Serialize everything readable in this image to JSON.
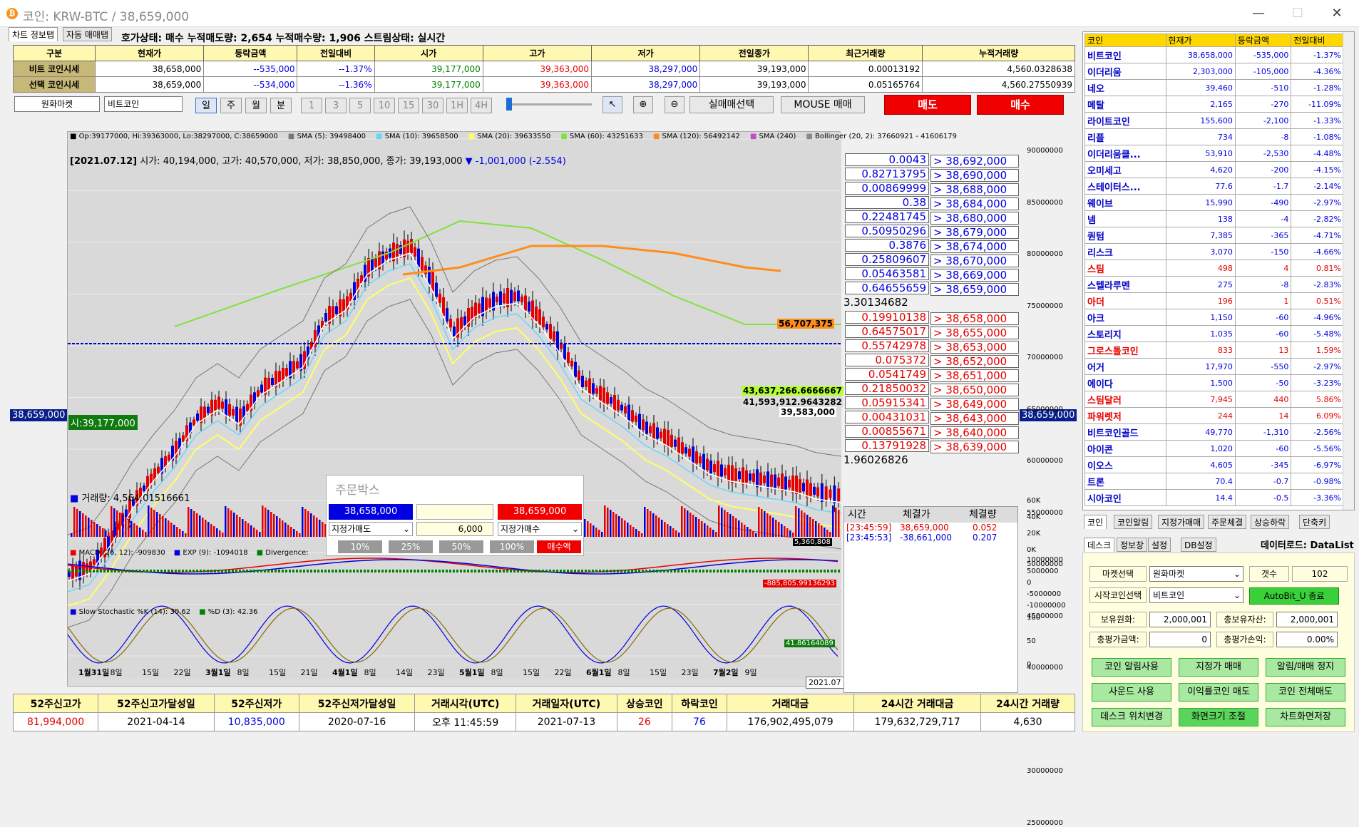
{
  "window": {
    "title": "코인: KRW-BTC / 38,659,000",
    "min": "—",
    "max": "☐",
    "close": "✕"
  },
  "tabs": {
    "chart_info": "차트 정보탭",
    "auto_trade": "자동 매매탭"
  },
  "status_text": "호가상태: 매수 누적매도량: 2,654 누적매수량: 1,906 스트림상태: 실시간",
  "summary": {
    "headers": [
      "구분",
      "현재가",
      "등락금액",
      "전일대비",
      "시가",
      "고가",
      "저가",
      "전일종가",
      "최근거래량",
      "누적거래량"
    ],
    "rows": [
      {
        "label": "비트 코인시세",
        "cells": [
          "38,658,000",
          "--535,000",
          "--1.37%",
          "39,177,000",
          "39,363,000",
          "38,297,000",
          "39,193,000",
          "0.00013192",
          "4,560.0328638"
        ]
      },
      {
        "label": "선택 코인시세",
        "cells": [
          "38,659,000",
          "--534,000",
          "--1.36%",
          "39,177,000",
          "39,363,000",
          "38,297,000",
          "39,193,000",
          "0.05165764",
          "4,560.27550939"
        ]
      }
    ]
  },
  "toolbar": {
    "market": "원화마켓",
    "coin": "비트코인",
    "periods": [
      "일",
      "주",
      "월",
      "분"
    ],
    "minutes": [
      "1",
      "3",
      "5",
      "10",
      "15",
      "30",
      "1H",
      "4H"
    ],
    "real_trade": "실매매선택",
    "mouse_trade": "MOUSE 매매",
    "sell": "매도",
    "buy": "매수"
  },
  "chart": {
    "legend": [
      "Op:39177000, Hi:39363000, Lo:38297000, C:38659000",
      "SMA (5): 39498400",
      "SMA (10): 39658500",
      "SMA (20): 39633550",
      "SMA (60): 43251633",
      "SMA (120): 56492142",
      "SMA (240)",
      "Bollinger (20, 2): 37660921 - 41606179"
    ],
    "info_date": "[2021.07.12]",
    "info_text": " 시가: 40,194,000, 고가: 40,570,000, 저가: 38,850,000, 종가: 39,193,000",
    "info_change": "▼ -1,001,000 (-2.554)",
    "price_left": "38,659,000",
    "open_tag": "시:39,177,000",
    "price_right": "38,659,000",
    "tag_sma120": "56,707,375",
    "tag_a": "43,637,266.6666667",
    "tag_b": "41,593,912.9643282",
    "tag_c": "39,583,000",
    "yaxis": [
      "90000000",
      "85000000",
      "80000000",
      "75000000",
      "70000000",
      "65000000",
      "60000000",
      "55000000",
      "50000000",
      "45000000",
      "40000000",
      "35000000",
      "30000000",
      "25000000"
    ],
    "xaxis": [
      "1월31일",
      "8일",
      "15일",
      "22일",
      "3월1일",
      "8일",
      "15일",
      "21일",
      "4월1일",
      "8일",
      "14일",
      "23일",
      "5월1일",
      "8일",
      "15일",
      "22일",
      "6월1일",
      "8일",
      "15일",
      "23일",
      "7월2일",
      "9일"
    ],
    "xaxis_last": "2021.07",
    "volume_label": "거래량: 4,564.01516661",
    "volume_tag": "5,360,808",
    "vol_axis": [
      "60K",
      "40K",
      "20K",
      "0K"
    ],
    "macd_legend": [
      "MACD (26, 12): -909830",
      "EXP (9): -1094018",
      "Divergence:"
    ],
    "macd_tag": "-885,805.99136293",
    "macd_axis": [
      "10000000",
      "5000000",
      "0",
      "-5000000",
      "-10000000"
    ],
    "stoch_legend": [
      "Slow Stochastic %K (14): 30.62",
      "%D (3): 42.36"
    ],
    "stoch_tag": "41.86164089",
    "stoch_axis": [
      "100",
      "50",
      "0"
    ]
  },
  "orderbook": {
    "asks": [
      [
        "0.0043",
        "> 38,692,000"
      ],
      [
        "0.82713795",
        "> 38,690,000"
      ],
      [
        "0.00869999",
        "> 38,688,000"
      ],
      [
        "0.38",
        "> 38,684,000"
      ],
      [
        "0.22481745",
        "> 38,680,000"
      ],
      [
        "0.50950296",
        "> 38,679,000"
      ],
      [
        "0.3876",
        "> 38,674,000"
      ],
      [
        "0.25809607",
        "> 38,670,000"
      ],
      [
        "0.05463581",
        "> 38,669,000"
      ],
      [
        "0.64655659",
        "> 38,659,000"
      ]
    ],
    "ask_total": "3.30134682",
    "bids": [
      [
        "0.19910138",
        "> 38,658,000"
      ],
      [
        "0.64575017",
        "> 38,655,000"
      ],
      [
        "0.55742978",
        "> 38,653,000"
      ],
      [
        "0.075372",
        "> 38,652,000"
      ],
      [
        "0.0541749",
        "> 38,651,000"
      ],
      [
        "0.21850032",
        "> 38,650,000"
      ],
      [
        "0.05915341",
        "> 38,649,000"
      ],
      [
        "0.00431031",
        "> 38,643,000"
      ],
      [
        "0.00855671",
        "> 38,640,000"
      ],
      [
        "0.13791928",
        "> 38,639,000"
      ]
    ],
    "bid_total": "1.96026826"
  },
  "trades": {
    "headers": [
      "시간",
      "체결가",
      "체결량"
    ],
    "rows": [
      [
        "[23:45:59]",
        "38,659,000",
        "0.052"
      ],
      [
        "[23:45:53]",
        "-38,661,000",
        "0.207"
      ]
    ]
  },
  "orderbox": {
    "title": "주문박스",
    "buy_price": "38,658,000",
    "mid": "",
    "sell_price": "38,659,000",
    "sell_type": "지정가매도",
    "qty": "6,000",
    "buy_type": "지정가매수",
    "pcts": [
      "10%",
      "25%",
      "50%",
      "100%"
    ],
    "buy_amount": "매수액"
  },
  "coinlist": {
    "headers": [
      "코인",
      "현재가",
      "등락금액",
      "전일대비"
    ],
    "rows": [
      [
        "비트코인",
        "38,658,000",
        "-535,000",
        "-1.37%"
      ],
      [
        "이더리움",
        "2,303,000",
        "-105,000",
        "-4.36%"
      ],
      [
        "네오",
        "39,460",
        "-510",
        "-1.28%"
      ],
      [
        "메탈",
        "2,165",
        "-270",
        "-11.09%"
      ],
      [
        "라이트코인",
        "155,600",
        "-2,100",
        "-1.33%"
      ],
      [
        "리플",
        "734",
        "-8",
        "-1.08%"
      ],
      [
        "이더리움클...",
        "53,910",
        "-2,530",
        "-4.48%"
      ],
      [
        "오미세고",
        "4,620",
        "-200",
        "-4.15%"
      ],
      [
        "스테이터스...",
        "77.6",
        "-1.7",
        "-2.14%"
      ],
      [
        "웨이브",
        "15,990",
        "-490",
        "-2.97%"
      ],
      [
        "넴",
        "138",
        "-4",
        "-2.82%"
      ],
      [
        "퀀텀",
        "7,385",
        "-365",
        "-4.71%"
      ],
      [
        "리스크",
        "3,070",
        "-150",
        "-4.66%"
      ],
      [
        "스팀",
        "498",
        "4",
        "0.81%"
      ],
      [
        "스텔라루멘",
        "275",
        "-8",
        "-2.83%"
      ],
      [
        "아더",
        "196",
        "1",
        "0.51%"
      ],
      [
        "아크",
        "1,150",
        "-60",
        "-4.96%"
      ],
      [
        "스토리지",
        "1,035",
        "-60",
        "-5.48%"
      ],
      [
        "그로스톨코인",
        "833",
        "13",
        "1.59%"
      ],
      [
        "어거",
        "17,970",
        "-550",
        "-2.97%"
      ],
      [
        "에이다",
        "1,500",
        "-50",
        "-3.23%"
      ],
      [
        "스팀달러",
        "7,945",
        "440",
        "5.86%"
      ],
      [
        "파워렛저",
        "244",
        "14",
        "6.09%"
      ],
      [
        "비트코인골드",
        "49,770",
        "-1,310",
        "-2.56%"
      ],
      [
        "아이콘",
        "1,020",
        "-60",
        "-5.56%"
      ],
      [
        "이오스",
        "4,605",
        "-345",
        "-6.97%"
      ],
      [
        "트론",
        "70.4",
        "-0.7",
        "-0.98%"
      ],
      [
        "시아코인",
        "14.4",
        "-0.5",
        "-3.36%"
      ]
    ]
  },
  "side_tabs": [
    "코인",
    "코인알림",
    "지정가매매",
    "주문체결",
    "상승하락",
    "단축키"
  ],
  "sub_tabs": [
    "데스크",
    "정보창",
    "설정",
    "DB설정"
  ],
  "dataload": "데이터로드: DataList",
  "settings": {
    "market_label": "마켓선택",
    "market_value": "원화마켓",
    "count_label": "갯수",
    "count_value": "102",
    "start_label": "시작코인선택",
    "start_value": "비트코인",
    "autobit": "AutoBit_U 종료",
    "krw_label": "보유원화:",
    "krw_value": "2,000,001",
    "total_label": "총보유자산:",
    "total_value": "2,000,001",
    "eval_label": "총평가금액:",
    "eval_value": "0",
    "pnl_label": "총평가손익:",
    "pnl_value": "0.00%"
  },
  "green_buttons": [
    "코인 알림사용",
    "지정가 매매",
    "알림/매매 정지",
    "사운드 사용",
    "이익률코인 매도",
    "코인 전체매도",
    "데스크 위치변경",
    "화면크기 조절",
    "차트화면저장"
  ],
  "bottom": {
    "headers": [
      "52주신고가",
      "52주신고가달성일",
      "52주신저가",
      "52주신저가달성일",
      "거래시각(UTC)",
      "거래일자(UTC)",
      "상승코인",
      "하락코인",
      "거래대금",
      "24시간 거래대금",
      "24시간 거래량"
    ],
    "values": [
      "81,994,000",
      "2021-04-14",
      "10,835,000",
      "2020-07-16",
      "오후 11:45:59",
      "2021-07-13",
      "26",
      "76",
      "176,902,495,079",
      "179,632,729,717",
      "4,630"
    ]
  },
  "colors": {
    "up": "#e60000",
    "down": "#0000e0",
    "header": "#fff8b0",
    "accent_green": "#a8e8a0"
  }
}
